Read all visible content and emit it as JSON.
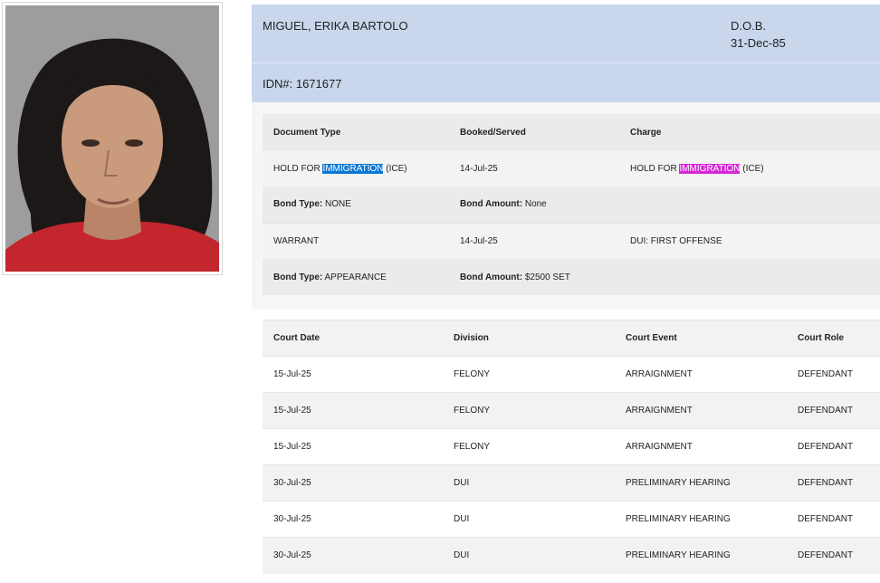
{
  "record": {
    "name": "MIGUEL, ERIKA BARTOLO",
    "dob_label": "D.O.B.",
    "dob": "31-Dec-85",
    "idn": "IDN#: 1671677"
  },
  "charges": {
    "headers": [
      "Document Type",
      "Booked/Served",
      "Charge"
    ],
    "bond_type_label": "Bond Type:",
    "bond_amount_label": "Bond Amount:",
    "items": [
      {
        "doc_pre": "HOLD FOR ",
        "doc_hl": "IMMIGRATION",
        "doc_post": " (ICE)",
        "booked": "14-Jul-25",
        "charge_pre": "HOLD FOR ",
        "charge_hl": "IMMIGRATION",
        "charge_post": " (ICE)",
        "bond_type": " NONE",
        "bond_amount": " None"
      },
      {
        "doc": "WARRANT",
        "booked": "14-Jul-25",
        "charge": "DUI: FIRST OFFENSE",
        "bond_type": " APPEARANCE",
        "bond_amount": " $2500 SET"
      }
    ]
  },
  "court": {
    "headers": [
      "Court Date",
      "Division",
      "Court Event",
      "Court Role"
    ],
    "rows": [
      [
        "15-Jul-25",
        "FELONY",
        "ARRAIGNMENT",
        "DEFENDANT"
      ],
      [
        "15-Jul-25",
        "FELONY",
        "ARRAIGNMENT",
        "DEFENDANT"
      ],
      [
        "15-Jul-25",
        "FELONY",
        "ARRAIGNMENT",
        "DEFENDANT"
      ],
      [
        "30-Jul-25",
        "DUI",
        "PRELIMINARY HEARING",
        "DEFENDANT"
      ],
      [
        "30-Jul-25",
        "DUI",
        "PRELIMINARY HEARING",
        "DEFENDANT"
      ],
      [
        "30-Jul-25",
        "DUI",
        "PRELIMINARY HEARING",
        "DEFENDANT"
      ]
    ]
  },
  "colors": {
    "header_bg": "#c9d6ec",
    "highlight_blue": "#0a77d4",
    "highlight_magenta": "#d627d6"
  }
}
